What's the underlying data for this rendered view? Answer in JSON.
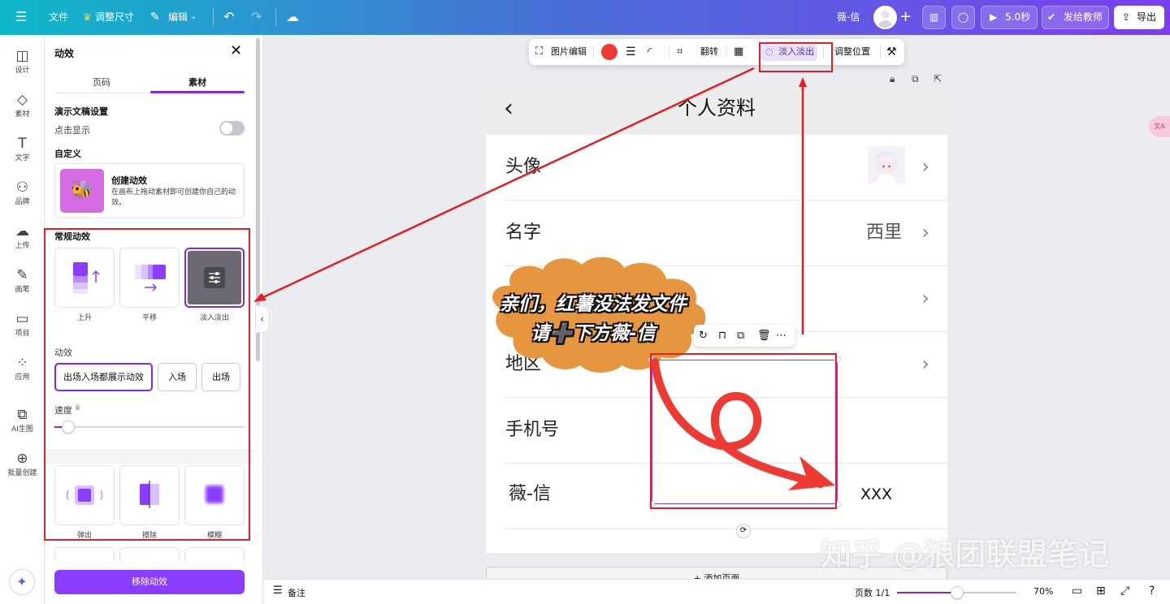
{
  "topbar": {
    "menu_icon": "hamburger-icon",
    "file_label": "文件",
    "resize_label": "调整尺寸",
    "edit_label": "编辑",
    "user_name": "薇-信",
    "play_label": "5.0秒",
    "send_teacher_label": "发给教师",
    "export_label": "导出"
  },
  "rail": {
    "items": [
      {
        "label": "设计",
        "icon": "layout-icon"
      },
      {
        "label": "素材",
        "icon": "shapes-icon"
      },
      {
        "label": "文字",
        "icon": "text-icon"
      },
      {
        "label": "品牌",
        "icon": "brand-icon"
      },
      {
        "label": "上传",
        "icon": "upload-icon"
      },
      {
        "label": "画笔",
        "icon": "pen-icon"
      },
      {
        "label": "项目",
        "icon": "folder-icon"
      },
      {
        "label": "应用",
        "icon": "apps-icon"
      },
      {
        "label": "AI生图",
        "icon": "ai-image-icon"
      },
      {
        "label": "批量创建",
        "icon": "bulk-create-icon"
      }
    ]
  },
  "panel": {
    "title": "动效",
    "tabs": [
      {
        "label": "页码"
      },
      {
        "label": "素材"
      }
    ],
    "presentation_heading": "演示文稿设置",
    "click_to_show_label": "点击显示",
    "custom_heading": "自定义",
    "create_title": "创建动效",
    "create_desc": "在画布上拖动素材即可创建你自己的动效。",
    "regular_heading": "常规动效",
    "effects": [
      {
        "label": "上升"
      },
      {
        "label": "平移"
      },
      {
        "label": "淡入淡出"
      }
    ],
    "anim_heading": "动效",
    "anim_options": [
      {
        "label": "出场入场都展示动效"
      },
      {
        "label": "入场"
      },
      {
        "label": "出场"
      }
    ],
    "speed_label": "速度",
    "speed_level": 0.07,
    "more_effects": [
      {
        "label": "弹出"
      },
      {
        "label": "擦除"
      },
      {
        "label": "模糊"
      }
    ],
    "remove_label": "移除动效"
  },
  "context_toolbar": {
    "image_edit_label": "图片编辑",
    "flip_label": "翻转",
    "fade_label": "淡入淡出",
    "position_label": "调整位置",
    "color": "#ef3a33"
  },
  "canvas": {
    "title": "个人资料",
    "rows": [
      {
        "label": "头像",
        "value": ""
      },
      {
        "label": "名字",
        "value": "西里"
      },
      {
        "label": "",
        "value": ""
      },
      {
        "label": "地区",
        "value": ""
      },
      {
        "label": "手机号",
        "value": ""
      },
      {
        "label": "薇-信",
        "value": "XXX"
      }
    ],
    "bubble_line1": "亲们，红薯没法发文件",
    "bubble_line2": "请➕下方薇-信",
    "add_page_label": "+ 添加页面"
  },
  "bottom": {
    "notes_label": "备注",
    "pages_label": "页数 1/1",
    "zoom_label": "70%",
    "zoom_level": 0.5
  },
  "watermark": "知乎 @狼团联盟笔记",
  "pink_pill_label": "文A",
  "colors": {
    "accent": "#7d2ae8",
    "annotation_red": "#e31e24",
    "cloud": "#e5963e"
  }
}
